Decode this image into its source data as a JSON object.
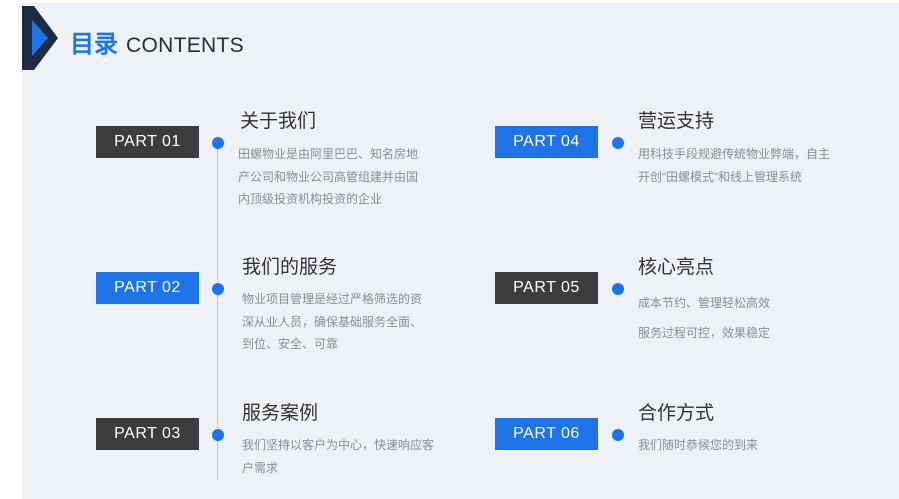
{
  "header": {
    "title_cn": "目录",
    "title_en": "CONTENTS"
  },
  "colors": {
    "accent": "#1e73e6",
    "dark": "#3c3c3c",
    "text": "#333333",
    "muted": "#8a8f96"
  },
  "items": [
    {
      "part": "PART 01",
      "style": "dark",
      "heading": "关于我们",
      "lines": [
        "田螺物业是由阿里巴巴、知名房地",
        "产公司和物业公司高管组建并由国",
        "内顶级投资机构投资的企业"
      ]
    },
    {
      "part": "PART 02",
      "style": "blue",
      "heading": "我们的服务",
      "lines": [
        "物业项目管理是经过严格筛选的资",
        "深从业人员，确保基础服务全面、",
        "到位、安全、可靠"
      ]
    },
    {
      "part": "PART 03",
      "style": "dark",
      "heading": "服务案例",
      "lines": [
        "我们坚持以客户为中心，快速响应客",
        "户需求"
      ]
    },
    {
      "part": "PART 04",
      "style": "blue",
      "heading": "营运支持",
      "lines": [
        "用科技手段规避传统物业弊端，自主",
        "开创“田螺模式”和线上管理系统"
      ]
    },
    {
      "part": "PART 05",
      "style": "dark",
      "heading": "核心亮点",
      "lines": [
        "成本节约、管理轻松高效",
        "服务过程可控，效果稳定"
      ]
    },
    {
      "part": "PART 06",
      "style": "blue",
      "heading": "合作方式",
      "lines": [
        "我们随时恭候您的到来"
      ]
    }
  ]
}
